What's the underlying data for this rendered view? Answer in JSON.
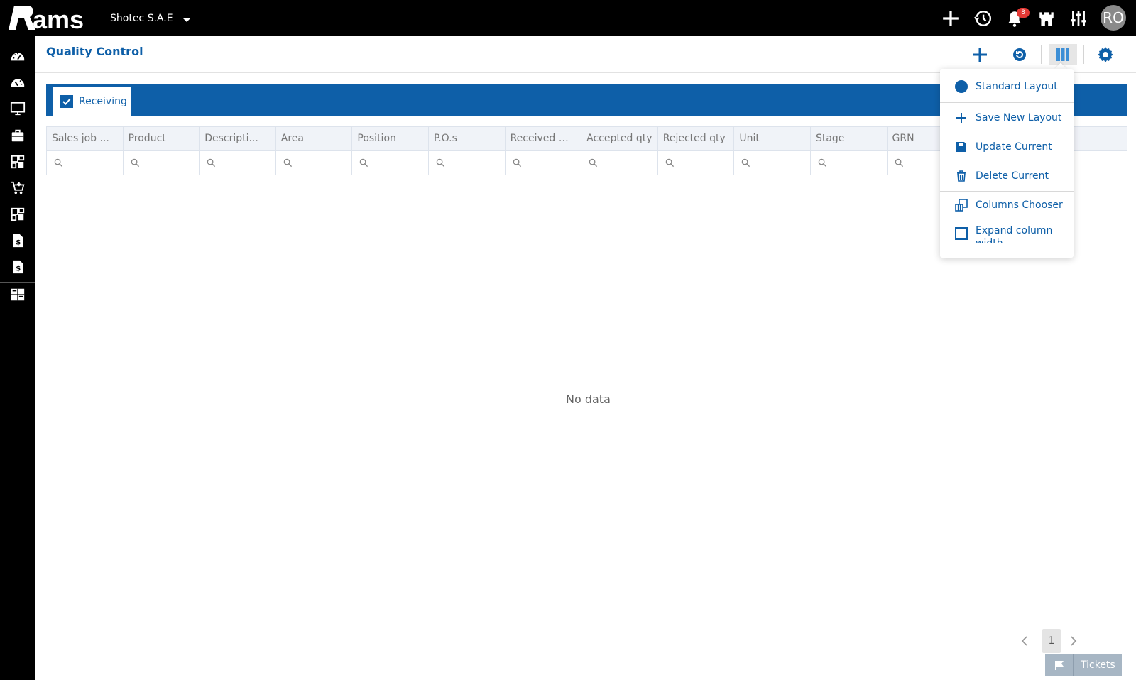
{
  "topbar": {
    "company": "Shotec S.A.E",
    "notification_count": "8",
    "avatar_initials": "RO",
    "icons": [
      "plus-icon",
      "history-icon",
      "bell-icon",
      "castle-icon",
      "sliders-icon"
    ]
  },
  "sidebar": {
    "icons": [
      "dashboard-icon",
      "dashboard-alt-icon",
      "monitor-icon",
      "briefcase-icon",
      "modules-icon",
      "cart-icon",
      "modules-alt-icon",
      "invoice-icon",
      "invoice-alt-icon",
      "reports-icon"
    ]
  },
  "page": {
    "title": "Quality Control"
  },
  "tabs": [
    {
      "label": "Receiving"
    }
  ],
  "grid": {
    "columns": [
      "Sales job ...",
      "Product",
      "Descripti...",
      "Area",
      "Position",
      "P.O.s",
      "Received Qty",
      "Accepted qty",
      "Rejected qty",
      "Unit",
      "Stage",
      "GRN",
      ""
    ],
    "empty_text": "No data"
  },
  "pager": {
    "current_page": "1"
  },
  "tickets": {
    "label": "Tickets"
  },
  "layout_menu": {
    "items": [
      {
        "label": "Standard Layout",
        "icon": "circle-icon"
      },
      {
        "label": "Save New Layout",
        "icon": "plus-icon"
      },
      {
        "label": "Update Current",
        "icon": "save-icon"
      },
      {
        "label": "Delete Current",
        "icon": "trash-icon"
      },
      {
        "label": "Columns Chooser",
        "icon": "columns-icon"
      },
      {
        "label": "Expand column width",
        "icon": "square-icon"
      }
    ]
  },
  "colors": {
    "brand": "#0e5fa8",
    "topbar": "#000000",
    "badge": "#e53935"
  }
}
